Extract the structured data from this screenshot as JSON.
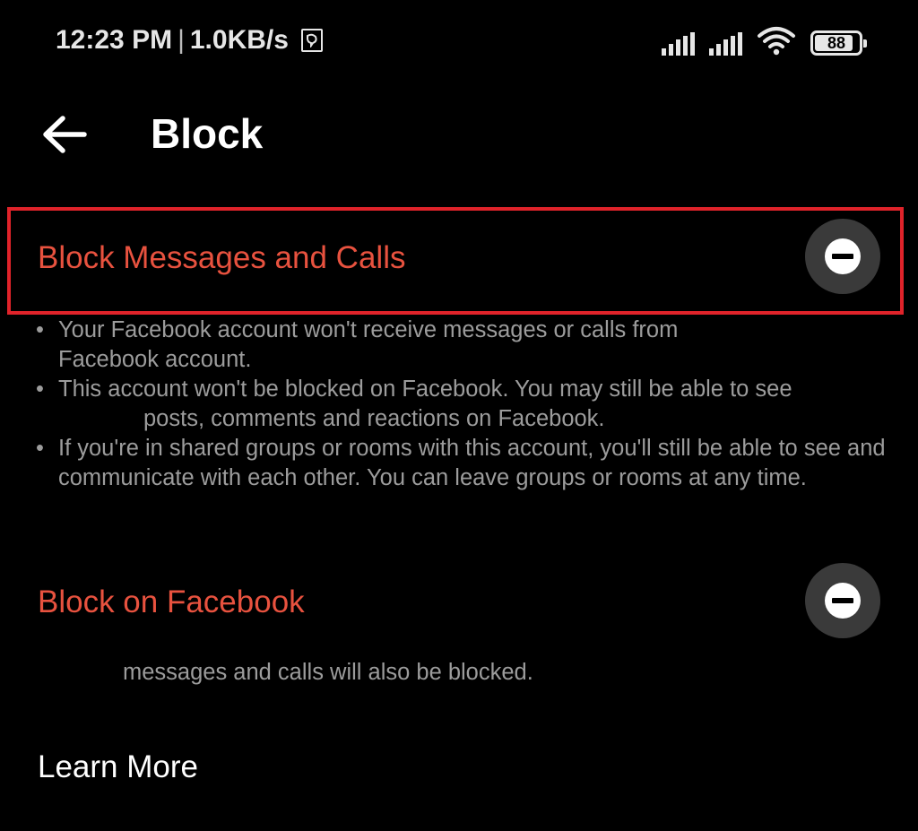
{
  "status_bar": {
    "time": "12:23 PM",
    "separator": "|",
    "net_speed": "1.0KB/s",
    "notification_icon": "messenger-notification-icon",
    "signal_icons": [
      "signal-icon",
      "signal-icon"
    ],
    "wifi_icon": "wifi-icon",
    "battery_level": "88",
    "battery_fraction": 0.88
  },
  "header": {
    "back_icon": "back-arrow-icon",
    "title": "Block"
  },
  "options": {
    "block_messages": {
      "label": "Block Messages and Calls",
      "toggle_icon": "minus-circle-icon",
      "highlight_color": "#e0232a"
    },
    "block_facebook": {
      "label": "Block on Facebook",
      "toggle_icon": "minus-circle-icon",
      "description": "messages and calls will also be blocked."
    }
  },
  "bullets": [
    {
      "line1": "Your Facebook account won't receive messages or calls from",
      "line2": "Facebook account."
    },
    {
      "line1": "This account won't be blocked on Facebook. You may still be able to see",
      "line2": "posts, comments and reactions on Facebook."
    },
    {
      "text": "If you're in shared groups or rooms with this account, you'll still be able to see and communicate with each other. You can leave groups or rooms at any time."
    }
  ],
  "footer": {
    "learn_more": "Learn More"
  },
  "colors": {
    "background": "#000000",
    "accent_red": "#e8523f",
    "secondary_text": "#9c9c9c",
    "toggle_bg": "#3a3a3a"
  }
}
